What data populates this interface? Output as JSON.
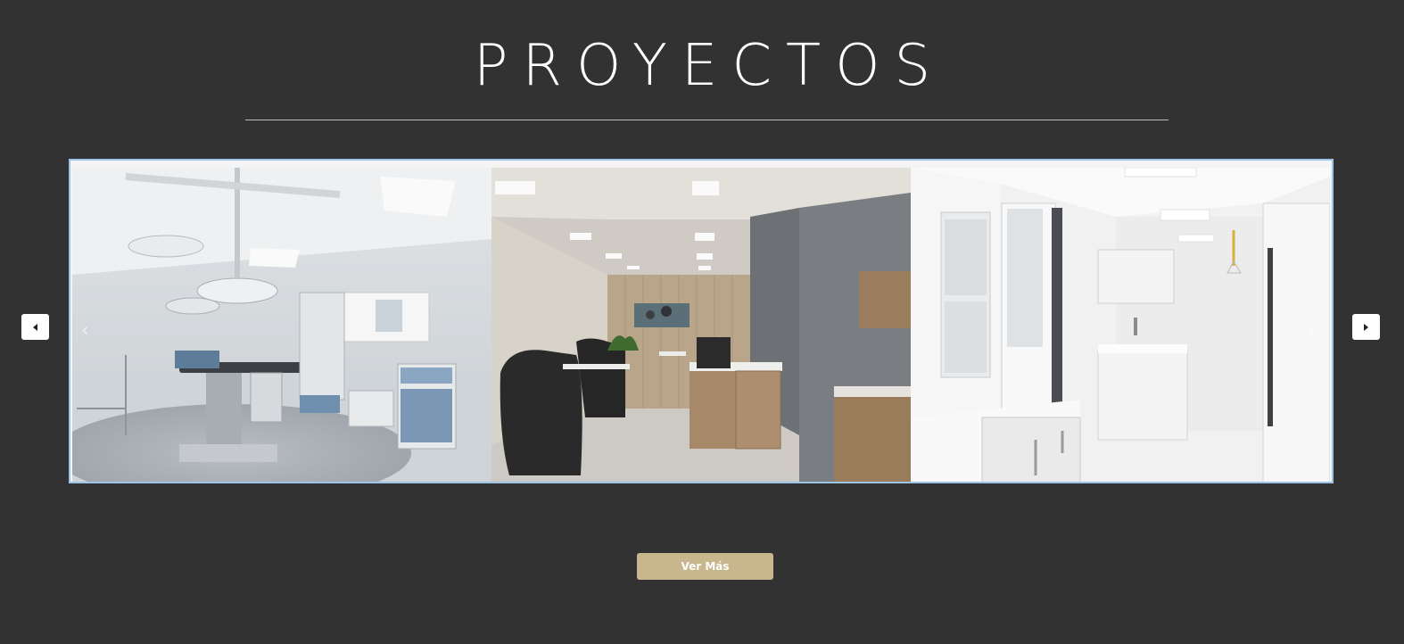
{
  "section": {
    "title": "PROYECTOS"
  },
  "carousel": {
    "prev_icon": "caret-left-icon",
    "next_icon": "caret-right-icon",
    "slides": [
      {
        "icon": "operating-room-photo"
      },
      {
        "icon": "lounge-room-photo"
      },
      {
        "icon": "clean-room-photo"
      }
    ]
  },
  "cta": {
    "label": "Ver Más"
  },
  "colors": {
    "background": "#323232",
    "accent_button": "#c8b68c",
    "carousel_border": "#9cc3e8",
    "title": "#ffffff"
  }
}
